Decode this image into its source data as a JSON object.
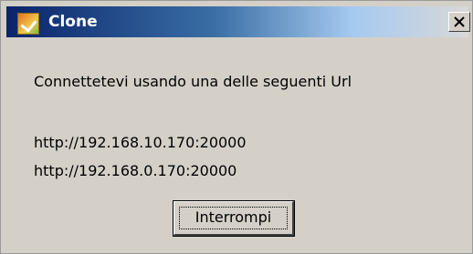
{
  "window": {
    "title": "Clone",
    "app_icon": "app-icon",
    "close_icon": "close-x-icon",
    "title_colors": {
      "gradient_start": "#0a246a",
      "gradient_mid": "#3a6ea5",
      "gradient_end": "#d8d8d8"
    }
  },
  "content": {
    "message": "Connettetevi usando una delle seguenti Url",
    "urls": [
      "http://192.168.10.170:20000",
      "http://192.168.0.170:20000"
    ]
  },
  "buttons": {
    "interrompi_label": "Interrompi"
  }
}
